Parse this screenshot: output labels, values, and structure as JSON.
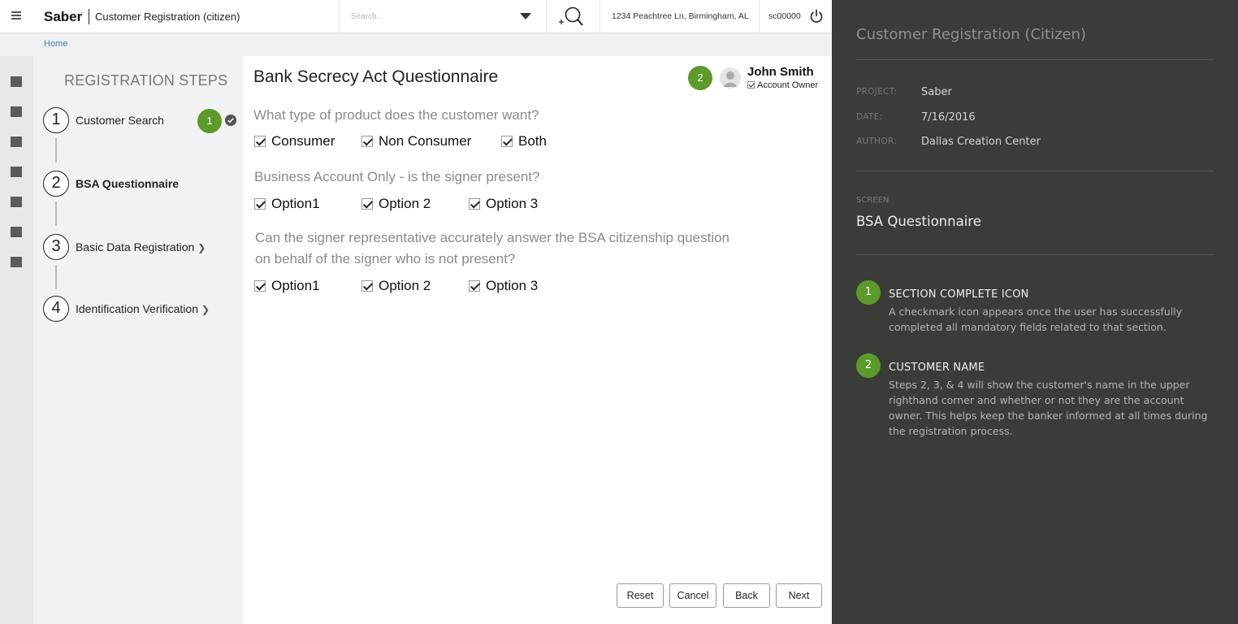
{
  "header": {
    "brand": "Saber",
    "context": "Customer Registration (citizen)",
    "search_placeholder": "Search...",
    "address": "1234 Peachtree Ln, Birmingham, AL",
    "user_id": "sc00000"
  },
  "breadcrumb": {
    "home": "Home"
  },
  "steps": {
    "title": "REGISTRATION STEPS",
    "items": [
      {
        "number": "1",
        "label": "Customer Search",
        "badge": "1"
      },
      {
        "number": "2",
        "label": "BSA Questionnaire"
      },
      {
        "number": "3",
        "label": "Basic Data Registration"
      },
      {
        "number": "4",
        "label": "Identification Verification"
      }
    ]
  },
  "main": {
    "title": "Bank Secrecy Act Questionnaire",
    "customer_badge": "2",
    "customer_name": "John Smith",
    "customer_role": "Account Owner",
    "questions": [
      {
        "text": "What type of product does the customer want?",
        "options": [
          "Consumer",
          "Non Consumer",
          "Both"
        ]
      },
      {
        "text": "Business Account Only - is the signer present?",
        "options": [
          "Option1",
          "Option 2",
          "Option 3"
        ]
      },
      {
        "text_line1": "Can the signer representative accurately answer the BSA citizenship question",
        "text_line2": "on behalf of the signer who is not present?",
        "options": [
          "Option1",
          "Option 2",
          "Option 3"
        ]
      }
    ],
    "buttons": {
      "reset": "Reset",
      "cancel": "Cancel",
      "back": "Back",
      "next": "Next"
    }
  },
  "annotation": {
    "title": "Customer Registration (Citizen)",
    "project_key": "PROJECT:",
    "project": "Saber",
    "date_key": "DATE:",
    "date": "7/16/2016",
    "author_key": "AUTHOR:",
    "author": "Dallas Creation Center",
    "screen_key": "SCREEN",
    "screen": "BSA Questionnaire",
    "notes": [
      {
        "badge": "1",
        "title": "SECTION COMPLETE ICON",
        "body": "A checkmark icon appears once the user has successfully completed all mandatory fields related to that section."
      },
      {
        "badge": "2",
        "title": "CUSTOMER NAME",
        "body": "Steps 2, 3, & 4 will show the customer's name in the upper righthand corner and whether or not they are the account owner.  This helps keep the banker informed at all times during the registration process."
      }
    ]
  },
  "colors": {
    "accent_green": "#5b9a2b",
    "link_blue": "#3a7fc1",
    "annotation_bg": "#3a3c37"
  },
  "icons": [
    "menu-icon",
    "dropdown-caret-icon",
    "search-icon",
    "power-icon",
    "rail-square-icon",
    "check-circle-icon",
    "chevron-right-icon",
    "avatar-icon",
    "checkbox-checked-icon"
  ]
}
